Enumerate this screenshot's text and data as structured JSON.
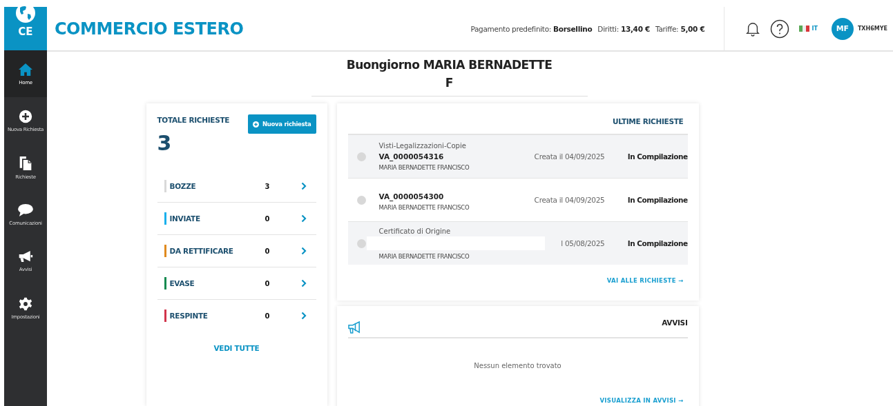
{
  "brand": {
    "short": "CE",
    "title": "COMMERCIO ESTERO"
  },
  "header": {
    "payment_label": "Pagamento predefinito:",
    "payment_value": "Borsellino",
    "rights_label": "Diritti:",
    "rights_value": "13,40 €",
    "fees_label": "Tariffe:",
    "fees_value": "5,00 €",
    "language": "IT",
    "avatar": "MF",
    "user_code": "TXH6MYE"
  },
  "sidebar": {
    "items": [
      {
        "label": "Home",
        "selected": true
      },
      {
        "label": "Nuova Richiesta",
        "selected": false
      },
      {
        "label": "Richieste",
        "selected": false
      },
      {
        "label": "Comunicazioni",
        "selected": false
      },
      {
        "label": "Avvisi",
        "selected": false
      },
      {
        "label": "Impostazioni",
        "selected": false
      }
    ]
  },
  "greeting": {
    "line_1": "Buongiorno MARIA BERNADETTE",
    "line_2": "F"
  },
  "totals": {
    "title": "TOTALE RICHIESTE",
    "new_button": "Nuova richiesta",
    "count": "3",
    "link": "VEDI TUTTE",
    "rows": [
      {
        "label": "BOZZE",
        "value": "3",
        "color": "#d9d9d9"
      },
      {
        "label": "INVIATE",
        "value": "0",
        "color": "#1ab0ec"
      },
      {
        "label": "DA RETTIFICARE",
        "value": "0",
        "color": "#e08a1e"
      },
      {
        "label": "EVASE",
        "value": "0",
        "color": "#138a4f"
      },
      {
        "label": "RESPINTE",
        "value": "0",
        "color": "#d1344b"
      }
    ]
  },
  "latest": {
    "title": "ULTIME RICHIESTE",
    "link": "VAI ALLE RICHIESTE →",
    "rows": [
      {
        "type": "Visti-Legalizzazioni-Copie",
        "code": "VA_0000054316",
        "owner": "MARIA BERNADETTE FRANCISCO",
        "date": "Creata il 04/09/2025",
        "status": "In Compilazione",
        "shaded": true,
        "redacted": false
      },
      {
        "code": "VA_0000054300",
        "owner": "MARIA BERNADETTE FRANCISCO",
        "date": "Creata il 04/09/2025",
        "status": "In Compilazione",
        "shaded": false,
        "redacted": false
      },
      {
        "type": "Certificato di Origine",
        "owner": "MARIA BERNADETTE FRANCISCO",
        "date": "l 05/08/2025",
        "status": "In Compilazione",
        "shaded": true,
        "redacted": true
      }
    ]
  },
  "notices": {
    "title": "AVVISI",
    "empty": "Nessun elemento trovato",
    "link": "VISUALIZZA IN AVVISI →"
  }
}
